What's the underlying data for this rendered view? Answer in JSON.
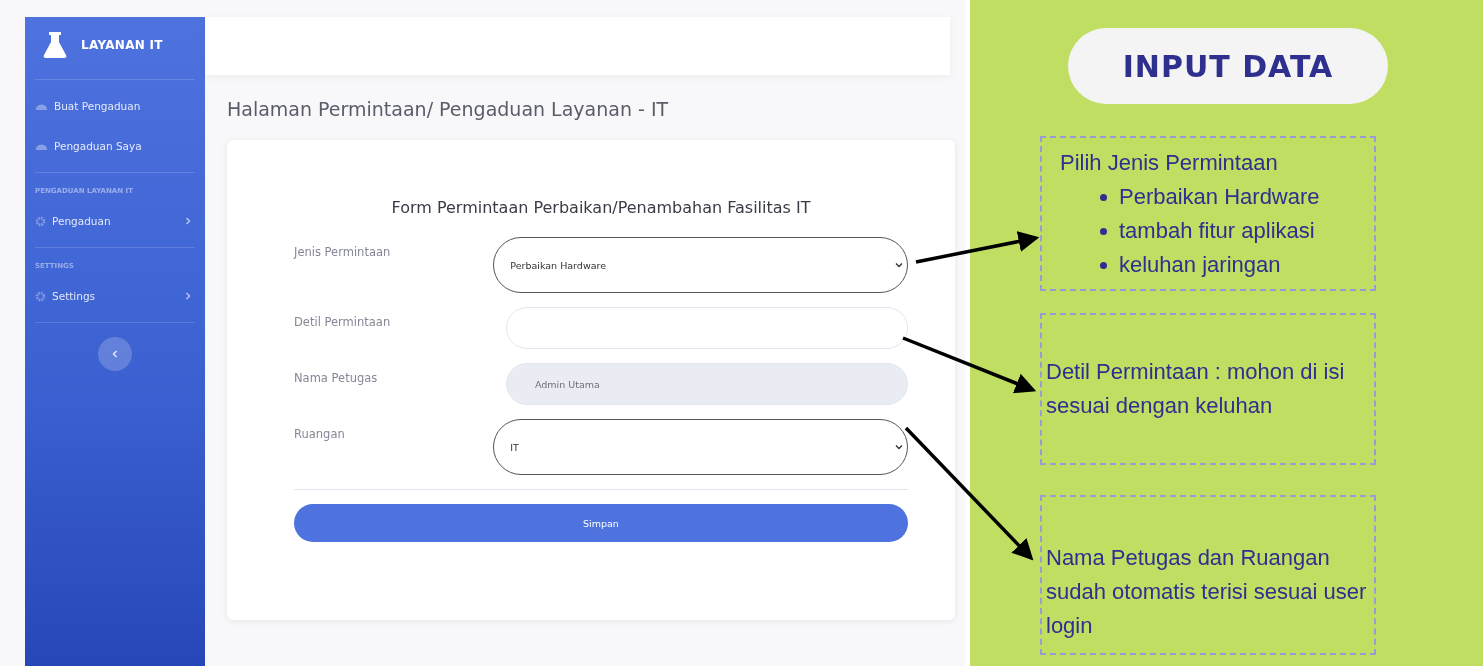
{
  "sidebar": {
    "brand": "LAYANAN IT",
    "items": [
      {
        "kind": "link",
        "label": "Buat Pengaduan"
      },
      {
        "kind": "link",
        "label": "Pengaduan Saya"
      },
      {
        "kind": "heading",
        "label": "PENGADUAN LAYANAN IT"
      },
      {
        "kind": "submenu",
        "label": "Pengaduan"
      },
      {
        "kind": "heading",
        "label": "SETTINGS"
      },
      {
        "kind": "submenu",
        "label": "Settings"
      }
    ]
  },
  "page_title": "Halaman Permintaan/ Pengaduan Layanan - IT",
  "form": {
    "title": "Form Permintaan Perbaikan/Penambahan Fasilitas IT",
    "fields": [
      {
        "kind": "select",
        "label": "Jenis Permintaan",
        "value": "Perbaikan Hardware"
      },
      {
        "kind": "text",
        "label": "Detil Permintaan"
      },
      {
        "kind": "readonly",
        "label": "Nama Petugas",
        "value": "Admin Utama"
      },
      {
        "kind": "select",
        "label": "Ruangan",
        "value": "IT"
      }
    ],
    "submit": "Simpan"
  },
  "annotation": {
    "title": "INPUT DATA",
    "notes": [
      {
        "heading": "Pilih Jenis Permintaan",
        "bullets": [
          "Perbaikan Hardware",
          "tambah fitur aplikasi",
          "keluhan jaringan"
        ]
      },
      {
        "text": "Detil Permintaan : mohon di isi sesuai dengan keluhan"
      },
      {
        "text": "Nama Petugas dan Ruangan sudah otomatis terisi sesuai user login"
      }
    ]
  }
}
